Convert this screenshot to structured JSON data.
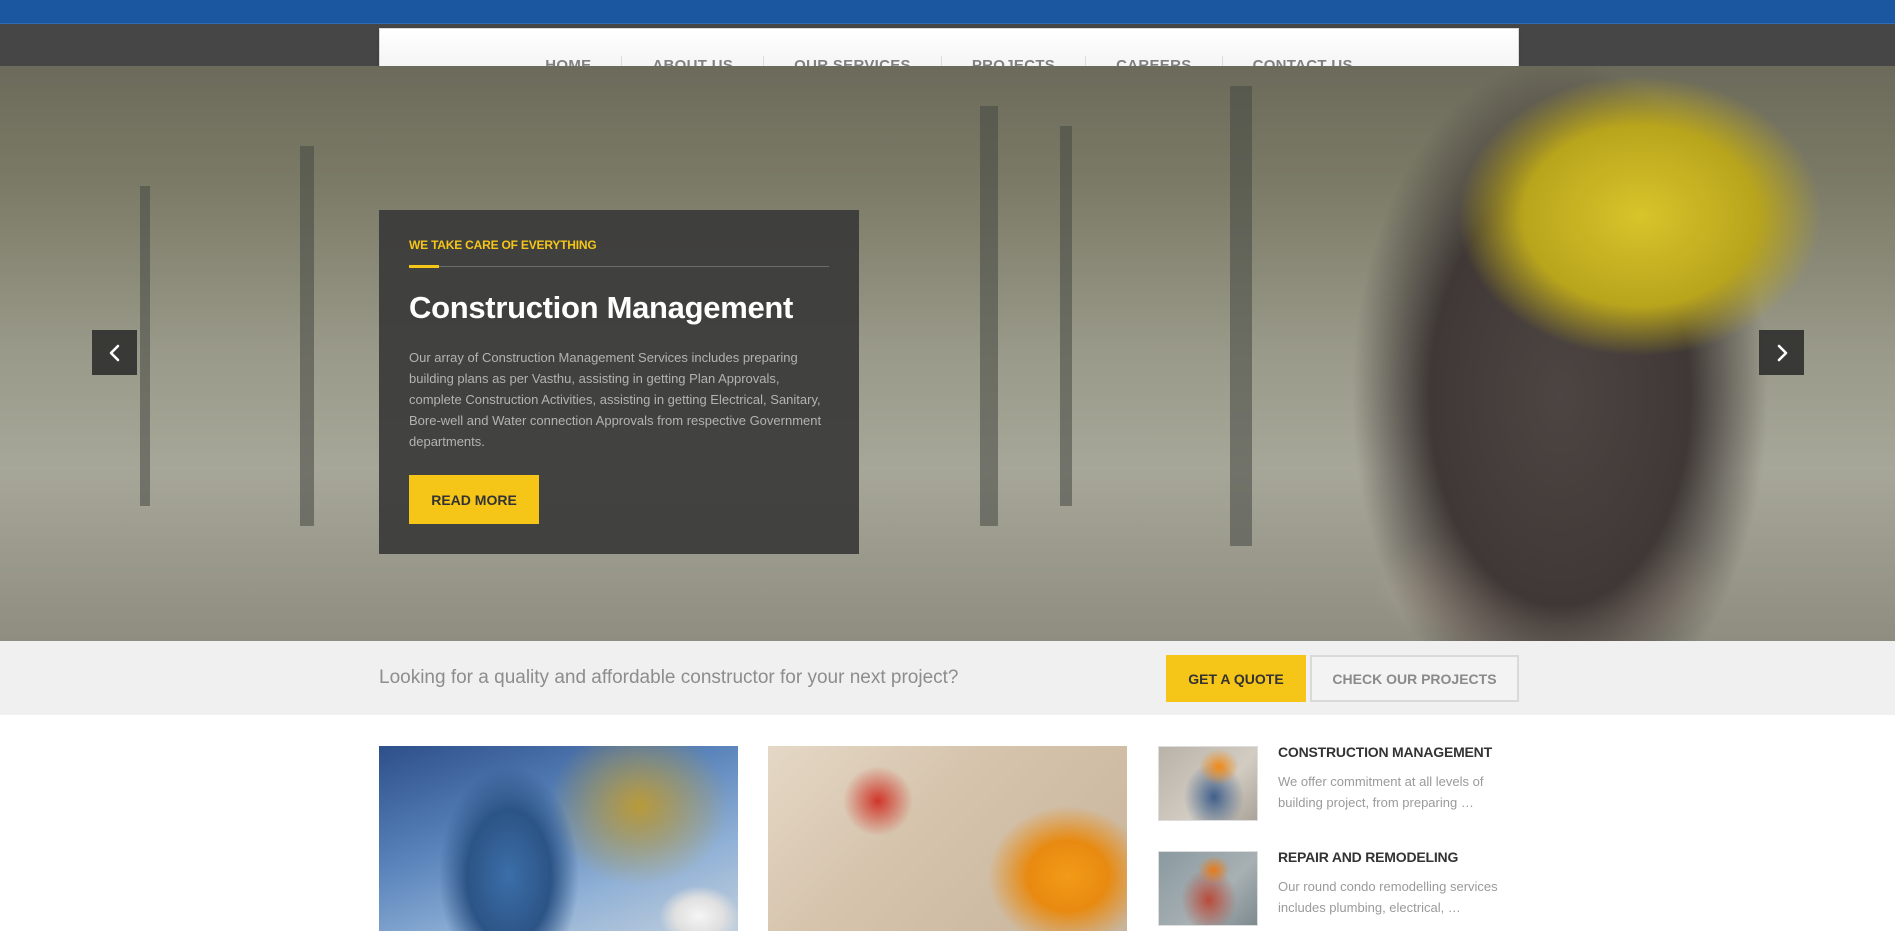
{
  "nav": {
    "items": [
      {
        "label": "HOME"
      },
      {
        "label": "ABOUT US"
      },
      {
        "label": "OUR SERVICES"
      },
      {
        "label": "PROJECTS"
      },
      {
        "label": "CAREERS"
      },
      {
        "label": "CONTACT US"
      }
    ]
  },
  "hero": {
    "tagline": "WE TAKE CARE OF EVERYTHING",
    "title": "Construction Management",
    "text": "Our array of Construction Management Services includes preparing building plans as per Vasthu, assisting in getting Plan Approvals, complete Construction Activities, assisting in getting Electrical, Sanitary, Bore-well and Water connection Approvals from respective Government departments.",
    "button": "READ MORE"
  },
  "cta": {
    "text": "Looking for a quality and affordable constructor for your next project?",
    "quote_button": "GET A QUOTE",
    "projects_button": "CHECK OUR PROJECTS"
  },
  "services": [
    {
      "title": "CONSTRUCTION MANAGEMENT",
      "text": "We offer commitment at all levels of building project, from preparing …"
    },
    {
      "title": "REPAIR AND REMODELING",
      "text": "Our round condo remodelling services includes plumbing, electrical, …"
    }
  ],
  "colors": {
    "top_bar": "#1b56a0",
    "accent": "#f5c518",
    "dark_panel": "#3a3a3a"
  },
  "icons": {
    "prev": "chevron-left-icon",
    "next": "chevron-right-icon",
    "dropdown": "caret-down-icon"
  }
}
